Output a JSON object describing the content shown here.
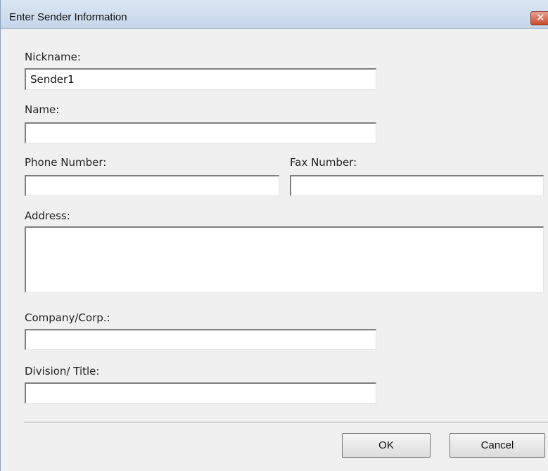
{
  "window": {
    "title": "Enter Sender Information",
    "close_glyph": "✕"
  },
  "fields": {
    "nickname": {
      "label": "Nickname:",
      "value": "Sender1"
    },
    "name": {
      "label": "Name:",
      "value": ""
    },
    "phone": {
      "label": "Phone Number:",
      "value": ""
    },
    "fax": {
      "label": "Fax Number:",
      "value": ""
    },
    "address": {
      "label": "Address:",
      "value": ""
    },
    "company": {
      "label": "Company/Corp.:",
      "value": ""
    },
    "division": {
      "label": "Division/ Title:",
      "value": ""
    }
  },
  "buttons": {
    "ok": "OK",
    "cancel": "Cancel"
  },
  "colors": {
    "titlebar": "#c6d6ea",
    "close_button": "#c94a2f",
    "dialog_background": "#f0f0f0"
  }
}
